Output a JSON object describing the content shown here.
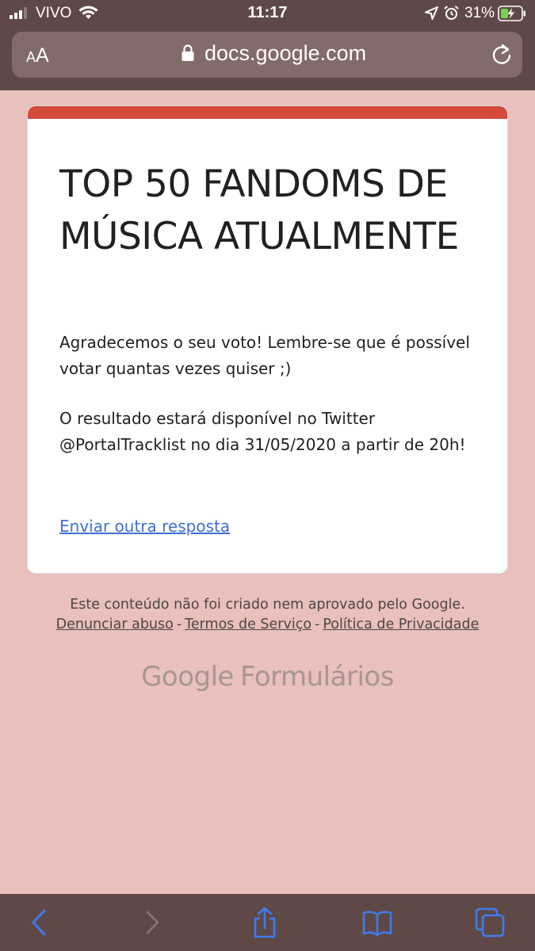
{
  "status_bar": {
    "carrier": "VIVO",
    "time": "11:17",
    "battery_percent": "31%"
  },
  "browser": {
    "text_size_small": "A",
    "text_size_large": "A",
    "url": "docs.google.com"
  },
  "form": {
    "title": "TOP 50 FANDOMS DE MÚSICA ATUALMENTE",
    "message_1": "Agradecemos o seu voto! Lembre-se que é possível votar quantas vezes quiser ;)",
    "message_2": "O resultado estará disponível no Twitter @PortalTracklist no dia 31/05/2020 a partir de 20h!",
    "submit_another_label": "Enviar outra resposta",
    "accent_color": "#d44b3e"
  },
  "footer": {
    "disclaimer": "Este conteúdo não foi criado nem aprovado pelo Google.",
    "report_abuse": "Denunciar abuso",
    "separator": "-",
    "terms": "Termos de Serviço",
    "privacy": "Política de Privacidade",
    "brand_google": "Google",
    "brand_product": "Formulários"
  },
  "toolbar": {
    "items": [
      "back",
      "forward",
      "share",
      "bookmarks",
      "tabs"
    ]
  },
  "icons": {
    "signal": "signal-icon",
    "wifi": "wifi-icon",
    "location": "location-arrow-icon",
    "alarm": "alarm-clock-icon",
    "battery": "battery-charging-icon",
    "lock": "lock-icon",
    "reload": "reload-icon"
  },
  "colors": {
    "page_background": "#e9c0bb",
    "chrome": "#5f4947",
    "toolbar_icon_active": "#3d7bf0",
    "toolbar_icon_disabled": "#8a7775",
    "link": "#3f6fd4"
  }
}
